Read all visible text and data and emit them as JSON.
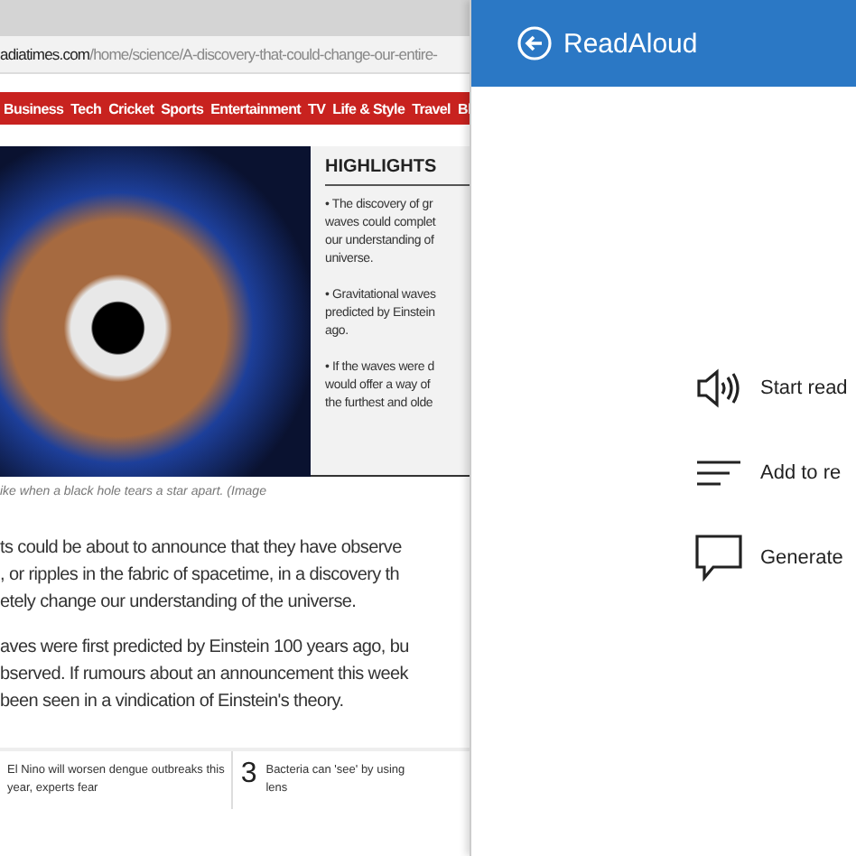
{
  "browser": {
    "url_domain": "adiatimes.com",
    "url_path": "/home/science/A-discovery-that-could-change-our-entire-"
  },
  "nav": [
    "Business",
    "Tech",
    "Cricket",
    "Sports",
    "Entertainment",
    "TV",
    "Life & Style",
    "Travel",
    "Bl"
  ],
  "highlights": {
    "title": "HIGHLIGHTS",
    "items": [
      {
        "lines": [
          "• The discovery of gr",
          "waves could complet",
          "our understanding of",
          "universe."
        ]
      },
      {
        "lines": [
          "• Gravitational waves",
          "predicted by Einstein",
          "ago."
        ]
      },
      {
        "lines": [
          "• If the waves were d",
          "would offer a way of",
          "the furthest and olde"
        ]
      }
    ]
  },
  "caption": "ike when a black hole tears a star apart. (Image",
  "paragraphs": [
    {
      "lines": [
        "ts could be about to announce that they have observe",
        ", or ripples in the fabric of spacetime, in a discovery th",
        "etely change our understanding of the universe."
      ]
    },
    {
      "lines": [
        "aves were first predicted by Einstein 100 years ago, bu",
        "bserved. If rumours about an announcement this week",
        "been seen in a vindication of Einstein's theory."
      ]
    }
  ],
  "related": [
    {
      "lines": [
        "El Nino will worsen dengue outbreaks this",
        "year, experts fear"
      ]
    },
    {
      "number": "3",
      "lines": [
        "Bacteria can 'see' by using",
        "lens"
      ]
    }
  ],
  "panel": {
    "title": "ReadAloud",
    "items": [
      {
        "kind": "speaker",
        "label": "Start read"
      },
      {
        "kind": "lines",
        "label": "Add to re"
      },
      {
        "kind": "comment",
        "label": "Generate"
      }
    ]
  }
}
